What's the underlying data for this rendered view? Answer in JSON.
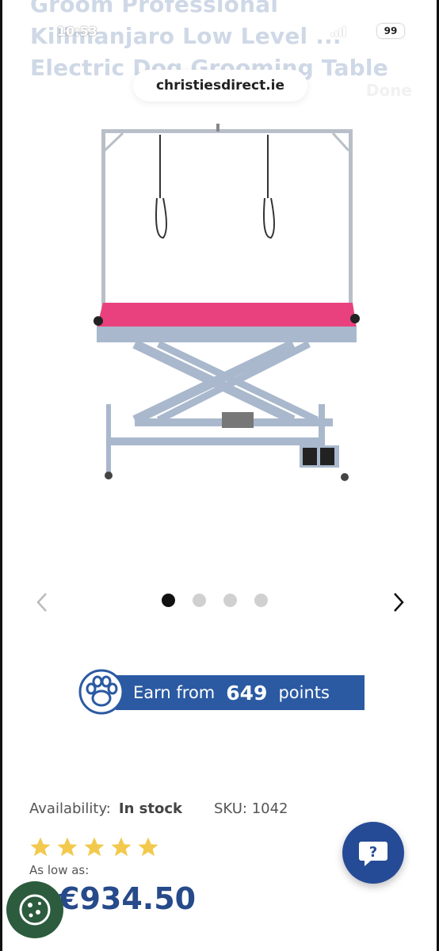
{
  "browser": {
    "page_title_faded": "Groom Professional Kilimanjaro Low Level ... Electric Dog Grooming Table",
    "status_time": "10:53",
    "battery_level": "99",
    "url": "christiesdirect.ie",
    "done_label": "Done"
  },
  "product": {
    "image_alt": "Electric dog grooming table with pink top",
    "carousel": {
      "total_slides": 4,
      "active_index": 0
    },
    "points": {
      "prefix": "Earn from",
      "value": "649",
      "suffix": "points"
    },
    "availability_label": "Availability:",
    "availability_value": "In stock",
    "sku": "SKU: 1042",
    "rating": 5,
    "low_as_label": "As low as:",
    "price": "€934.50"
  },
  "colors": {
    "brand_blue": "#2b5aa3",
    "star_yellow": "#f2c94c",
    "table_pink": "#e8417d",
    "cookie_green": "#2c5b3e"
  },
  "icons": {
    "left_arrow": "chevron-left-icon",
    "right_arrow": "chevron-right-icon",
    "paw": "paw-icon",
    "help": "question-icon",
    "cookie": "cookie-icon"
  }
}
